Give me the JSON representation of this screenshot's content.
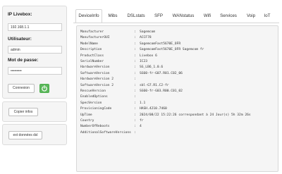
{
  "sidebar": {
    "ip_label": "IP Livebox:",
    "ip_value": "192.168.1.1",
    "user_label": "Utilisateur:",
    "user_value": "admin",
    "password_label": "Mot de passe:",
    "password_value": "•••••••••",
    "connect_label": "Connexion",
    "copy_label": "Copier infos",
    "export_label": "ext données dsl"
  },
  "tabs": [
    "DeviceInfo",
    "Mibs",
    "DSLstats",
    "SFP",
    "WANstatus",
    "Wifi",
    "Services",
    "Voip",
    "IoT"
  ],
  "active_tab": "DeviceInfo",
  "device_info": [
    {
      "key": "Manufacturer",
      "value": "Sagemcom"
    },
    {
      "key": "ManufacturerOUI",
      "value": "ACCF78"
    },
    {
      "key": "ModelName",
      "value": "SagemcomFast5670E_OFR"
    },
    {
      "key": "Description",
      "value": "SagemcomFast5670E_OFR Sagemcom fr"
    },
    {
      "key": "ProductClass",
      "value": "Livebox 6"
    },
    {
      "key": "SerialNumber",
      "value": "IC23"
    },
    {
      "key": "HardwareVersion",
      "value": "SG_LB6_1.0.6"
    },
    {
      "key": "SoftwareVersion",
      "value": "SG60-fr-G07.R01.C02_06"
    },
    {
      "key": "HardwareVersion 2",
      "value": ""
    },
    {
      "key": "SoftwareVersion 2",
      "value": "sbl-G7.R1.C2-fr"
    },
    {
      "key": "RescueVersion",
      "value": "SG60-fr-G03.R00.C01_02"
    },
    {
      "key": "EnabledOptions",
      "value": ""
    },
    {
      "key": "SpecVersion",
      "value": "1.1"
    },
    {
      "key": "ProvisioningCode",
      "value": "HASH.4210.7460"
    },
    {
      "key": "UpTime",
      "value": "2024/08/22 15:22:26 correspondant à 24 Jour(s) 5h 32m 26s"
    },
    {
      "key": "Country",
      "value": "fr"
    },
    {
      "key": "NumberOfReboots",
      "value": "4"
    },
    {
      "key": "AdditionalSoftwareVersions",
      "value": ""
    }
  ]
}
